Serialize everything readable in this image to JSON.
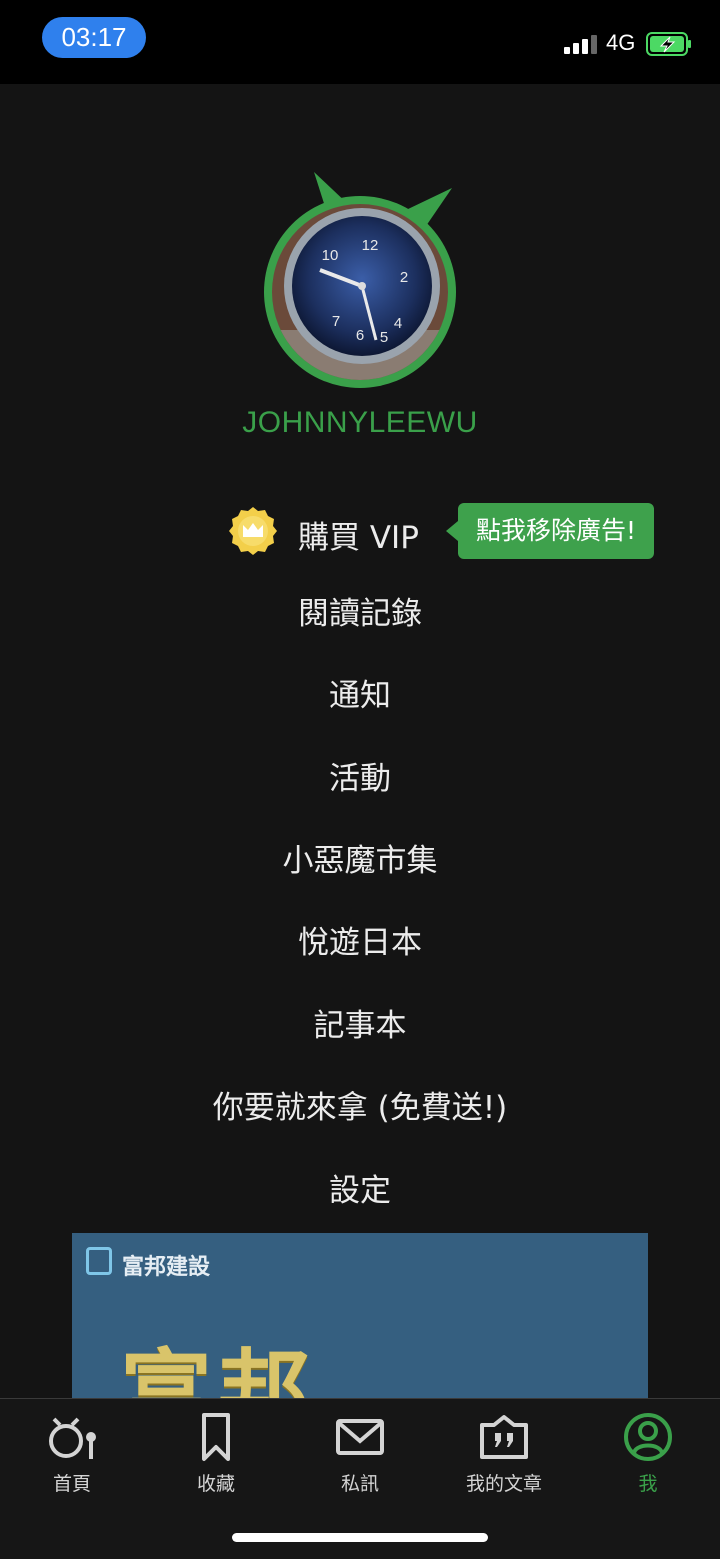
{
  "status_bar": {
    "time": "03:17",
    "network": "4G",
    "battery_state": "charging",
    "colors": {
      "time_pill": "#2f80ed",
      "battery": "#4cd964"
    }
  },
  "profile": {
    "username": "JOHNNYLEEWU",
    "avatar_icon": "wristwatch-avatar"
  },
  "vip": {
    "label": "購買 VIP",
    "badge_icon": "crown-badge-icon",
    "remove_ad_tip": "點我移除廣告!"
  },
  "menu": {
    "items": [
      {
        "label": "閱讀記錄"
      },
      {
        "label": "通知"
      },
      {
        "label": "活動"
      },
      {
        "label": "小惡魔市集"
      },
      {
        "label": "悅遊日本"
      },
      {
        "label": "記事本"
      },
      {
        "label": "你要就來拿 (免費送!)"
      },
      {
        "label": "設定"
      }
    ]
  },
  "ad": {
    "brand": "富邦建設",
    "headline": "富邦"
  },
  "tab_bar": {
    "tabs": [
      {
        "label": "首頁",
        "icon": "home-devil-icon"
      },
      {
        "label": "收藏",
        "icon": "bookmark-icon"
      },
      {
        "label": "私訊",
        "icon": "mail-icon"
      },
      {
        "label": "我的文章",
        "icon": "article-icon"
      },
      {
        "label": "我",
        "icon": "profile-icon",
        "active": true
      }
    ]
  },
  "colors": {
    "accent": "#3aa04a",
    "background": "#141414",
    "text": "#ececec"
  }
}
